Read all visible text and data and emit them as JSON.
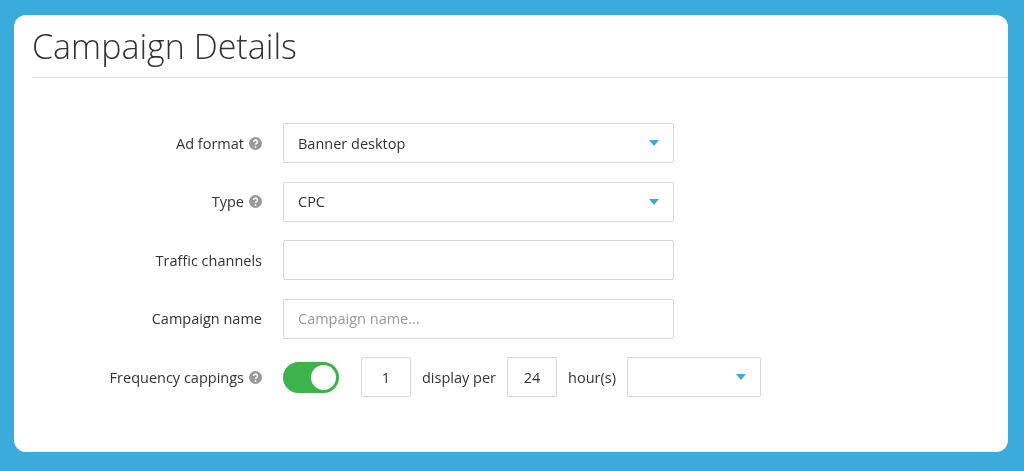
{
  "title": "Campaign Details",
  "fields": [
    {
      "kind": "select",
      "label": "Ad format",
      "help": true,
      "value": "Banner desktop"
    },
    {
      "kind": "select",
      "label": "Type",
      "help": true,
      "value": "CPC"
    },
    {
      "kind": "text",
      "label": "Traffic channels",
      "help": false
    },
    {
      "kind": "text",
      "label": "Campaign name",
      "help": false,
      "placeholder": "Campaign name..."
    },
    {
      "kind": "frequency",
      "label": "Frequency cappings",
      "help": true,
      "on": true,
      "count": "1",
      "per_text": "display per",
      "hours": "24",
      "unit_text": "hour(s)"
    }
  ]
}
